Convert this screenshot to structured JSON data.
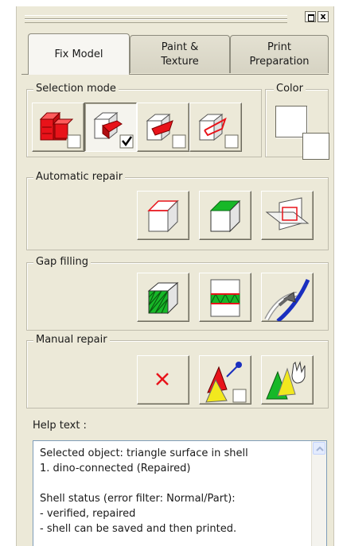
{
  "window": {
    "restore_icon": "restore-window-icon",
    "close_label": "x"
  },
  "tabs": [
    {
      "label": "Fix Model",
      "active": true
    },
    {
      "label": "Paint &\nTexture",
      "active": false
    },
    {
      "label": "Print\nPreparation",
      "active": false
    }
  ],
  "groups": {
    "selection_mode": "Selection mode",
    "color": "Color",
    "automatic_repair": "Automatic repair",
    "gap_filling": "Gap filling",
    "manual_repair": "Manual repair"
  },
  "selection_buttons": [
    {
      "icon": "select-shell-icon",
      "pressed": false
    },
    {
      "icon": "select-surface-icon",
      "pressed": true
    },
    {
      "icon": "select-triangle-icon",
      "pressed": false
    },
    {
      "icon": "select-edge-icon",
      "pressed": false
    }
  ],
  "color": {
    "swatch": "#ffffff"
  },
  "colors": {
    "red": "#e8131a",
    "green": "#17b828",
    "blue": "#1a2fbf",
    "yellow": "#f2e81e",
    "panel": "#ece9d8"
  },
  "help": {
    "label": "Help text :",
    "text": "Selected object: triangle surface in shell\n1. dino-connected (Repaired)\n\nShell status (error filter: Normal/Part):\n- verified, repaired\n- shell can be saved and then printed."
  }
}
